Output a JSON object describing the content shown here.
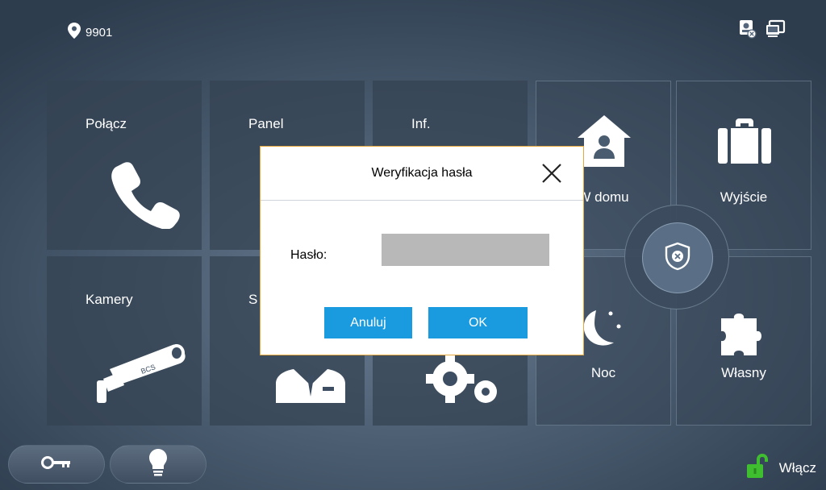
{
  "status": {
    "room_number": "9901"
  },
  "tiles": {
    "call": "Połącz",
    "panel": "Panel",
    "info": "Inf.",
    "cameras": "Kamery",
    "settings_partial": "S"
  },
  "modes": {
    "home": "W domu",
    "away": "Wyjście",
    "night": "Noc",
    "custom": "Własny"
  },
  "bottom": {
    "unlock_label": "Włącz"
  },
  "dialog": {
    "title": "Weryfikacja hasła",
    "password_label": "Hasło:",
    "password_value": "",
    "cancel_label": "Anuluj",
    "ok_label": "OK"
  },
  "colors": {
    "accent": "#1a9be0",
    "dialog_border": "#e6a83a",
    "unlock_green": "#3fbf2f"
  }
}
